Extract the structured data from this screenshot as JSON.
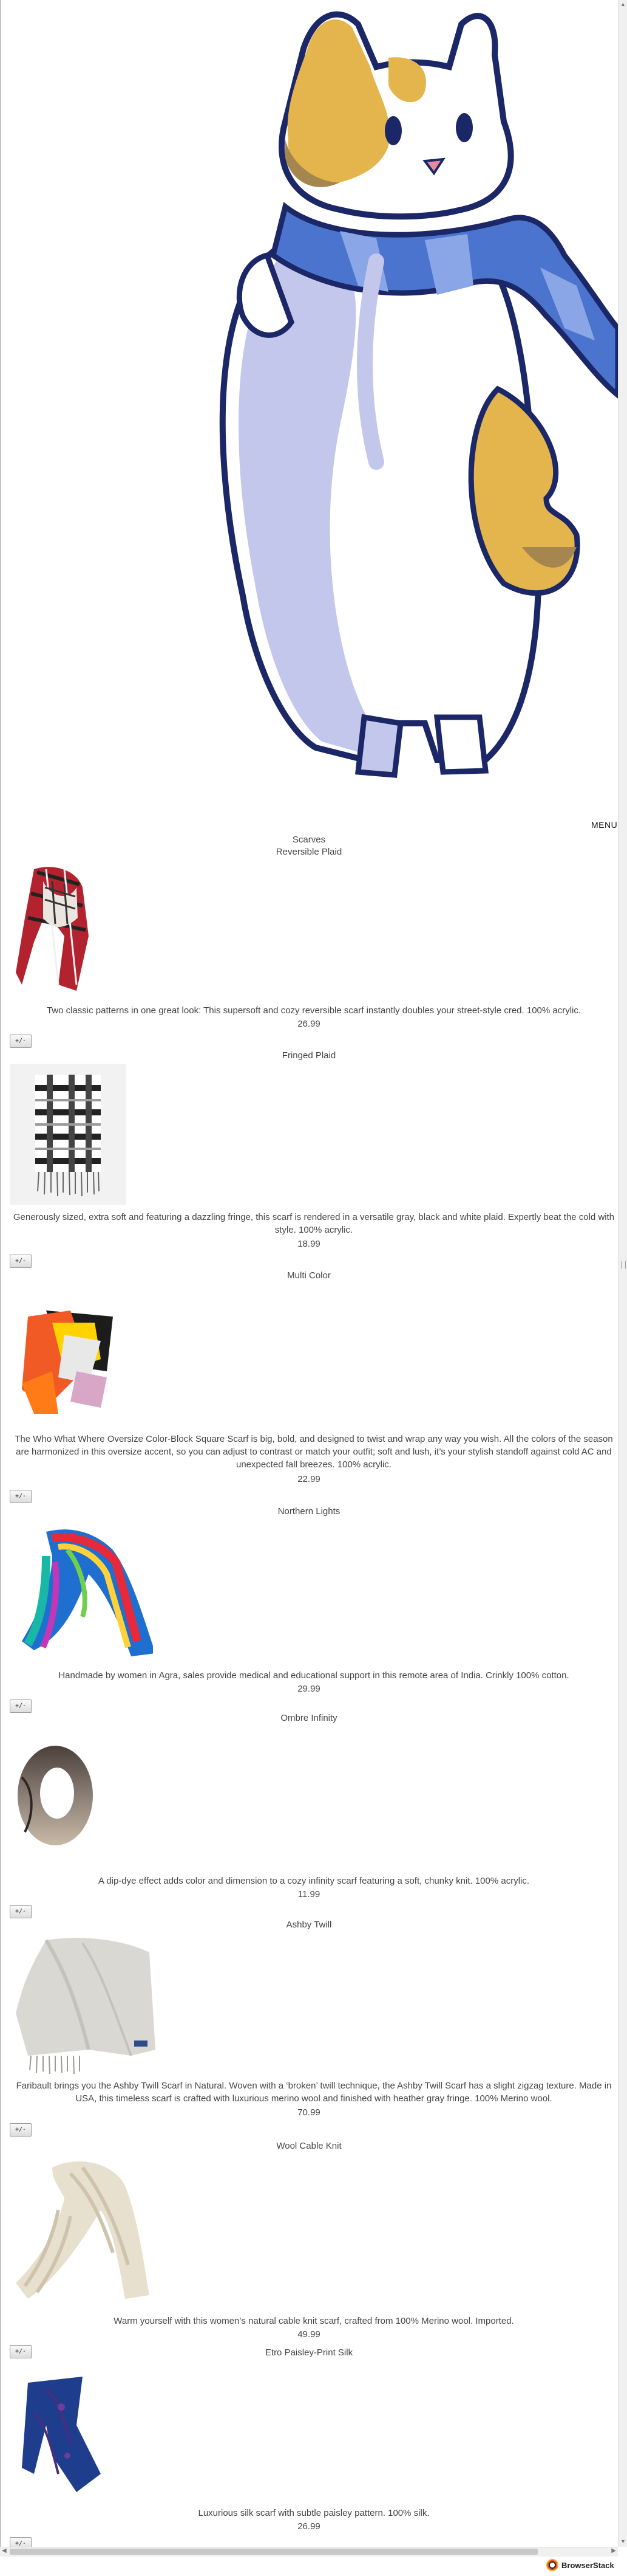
{
  "nav": {
    "cart_icon": "",
    "menu_label": "MENU"
  },
  "header": {
    "category": "Scarves",
    "first_title": "Reversible Plaid"
  },
  "add_label": "+/-",
  "products": [
    {
      "name": "Reversible Plaid",
      "description": "Two classic patterns in one great look: This supersoft and cozy reversible scarf instantly doubles your street-style cred. 100% acrylic.",
      "price": "26.99"
    },
    {
      "name": "Fringed Plaid",
      "description": "Generously sized, extra soft and featuring a dazzling fringe, this scarf is rendered in a versatile gray, black and white plaid. Expertly beat the cold with style. 100% acrylic.",
      "price": "18.99"
    },
    {
      "name": "Multi Color",
      "description": "The Who What Where Oversize Color-Block Square Scarf is big, bold, and designed to twist and wrap any way you wish. All the colors of the season are harmonized in this oversize accent, so you can adjust to contrast or match your outfit; soft and lush, it’s your stylish standoff against cold AC and unexpected fall breezes. 100% acrylic.",
      "price": "22.99"
    },
    {
      "name": "Northern Lights",
      "description": "Handmade by women in Agra, sales provide medical and educational support in this remote area of India. Crinkly 100% cotton.",
      "price": "29.99"
    },
    {
      "name": "Ombre Infinity",
      "description": "A dip-dye effect adds color and dimension to a cozy infinity scarf featuring a soft, chunky knit. 100% acrylic.",
      "price": "11.99"
    },
    {
      "name": "Ashby Twill",
      "description": "Faribault brings you the Ashby Twill Scarf in Natural. Woven with a ‘broken’ twill technique, the Ashby Twill Scarf has a slight zigzag texture. Made in USA, this timeless scarf is crafted with luxurious merino wool and finished with heather gray fringe. 100% Merino wool.",
      "price": "70.99"
    },
    {
      "name": "Wool Cable Knit",
      "description": "Warm yourself with this women’s natural cable knit scarf, crafted from 100% Merino wool. Imported.",
      "price": "49.99"
    },
    {
      "name": "Etro Paisley-Print Silk",
      "description": "Luxurious silk scarf with subtle paisley pattern. 100% silk.",
      "price": "26.99"
    }
  ],
  "browserstack": {
    "label": "BrowserStack"
  }
}
